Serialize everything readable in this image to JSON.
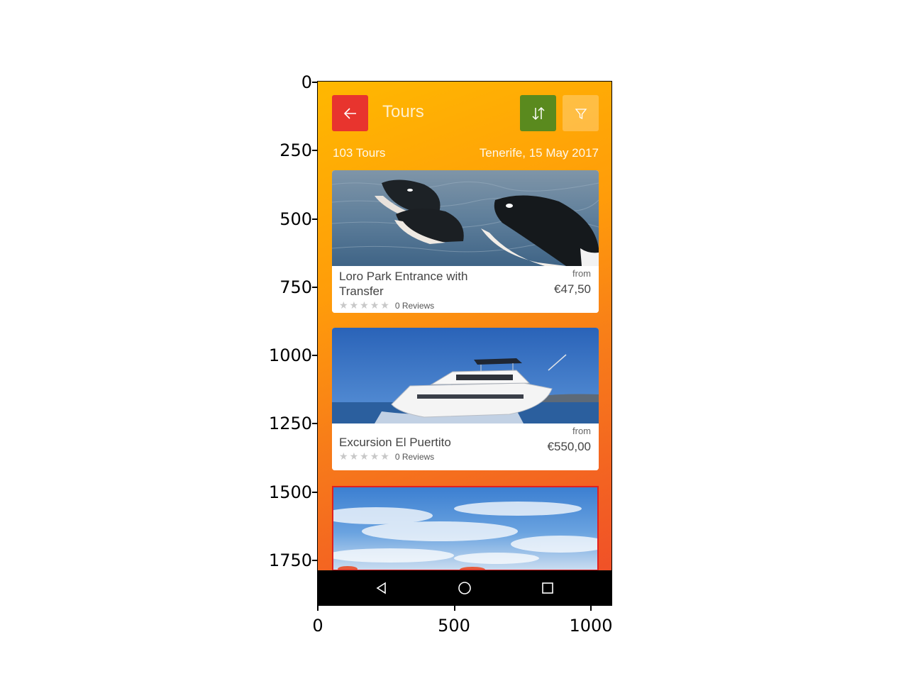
{
  "axes": {
    "yticks": [
      "0",
      "250",
      "500",
      "750",
      "1000",
      "1250",
      "1500",
      "1750"
    ],
    "xticks": [
      "0",
      "500",
      "1000"
    ]
  },
  "topbar": {
    "back_icon": "arrow-left-icon",
    "title": "Tours",
    "sort_icon": "sort-arrows-icon",
    "filter_icon": "filter-icon",
    "colors": {
      "back": "#e8342e",
      "sort": "#5a8a1e"
    }
  },
  "summary": {
    "count": "103 Tours",
    "location_date": "Tenerife, 15 May 2017"
  },
  "tours": [
    {
      "name": "Loro Park Entrance with Transfer",
      "from_label": "from",
      "price": "€47,50",
      "rating": 0,
      "reviews": "0  Reviews",
      "image": "orcas-photo"
    },
    {
      "name": "Excursion El Puertito",
      "from_label": "from",
      "price": "€550,00",
      "rating": 0,
      "reviews": "0  Reviews",
      "image": "yacht-photo"
    },
    {
      "image": "sky-photo"
    }
  ],
  "navbar": {
    "back_icon": "triangle-back-icon",
    "home_icon": "circle-home-icon",
    "recents_icon": "square-recents-icon"
  }
}
